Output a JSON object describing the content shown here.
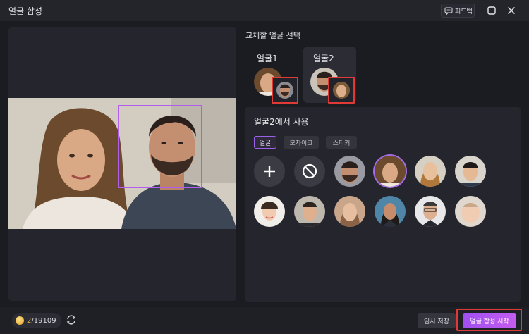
{
  "app": {
    "title": "얼굴 합성"
  },
  "titlebar": {
    "feedback_label": "피드백"
  },
  "panel": {
    "section_title": "교체할 얼굴 선택",
    "tabs": [
      {
        "label": "얼굴1",
        "active": false
      },
      {
        "label": "얼굴2",
        "active": true
      }
    ]
  },
  "library": {
    "title": "얼굴2에서 사용",
    "categories": [
      {
        "label": "얼굴",
        "active": true
      },
      {
        "label": "모자이크",
        "active": false
      },
      {
        "label": "스티커",
        "active": false
      }
    ]
  },
  "footer": {
    "credits_used": "2",
    "credits_total": "/19109",
    "temp_save_label": "임시 저장",
    "start_label": "얼굴 합성 시작"
  },
  "colors": {
    "accent": "#a65cf0",
    "highlight": "#e03a36",
    "coin": "#f0c040"
  }
}
